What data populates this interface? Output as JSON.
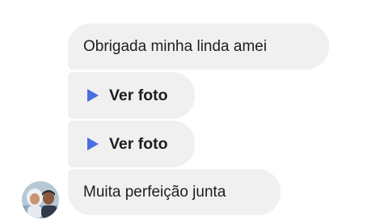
{
  "conversation": {
    "messages": [
      {
        "type": "text",
        "text": "Obrigada minha linda amei"
      },
      {
        "type": "photo",
        "icon": "play-icon",
        "label": "Ver foto"
      },
      {
        "type": "photo",
        "icon": "play-icon",
        "label": "Ver foto"
      },
      {
        "type": "text",
        "text": "Muita perfeição junta"
      }
    ],
    "sender": {
      "avatar": "profile-photo"
    }
  },
  "colors": {
    "bubble_background": "#f0f0f0",
    "text": "#1c1e21",
    "play_icon": "#4a6ee0"
  }
}
